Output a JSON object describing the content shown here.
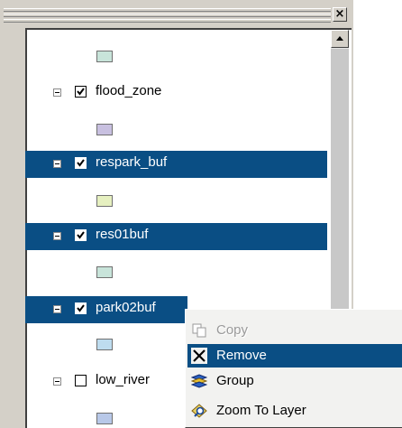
{
  "window": {
    "close_glyph": "×"
  },
  "toc": {
    "layers": [
      {
        "name": "flood_zone",
        "checked": true,
        "selected": false,
        "swatch_color": "#c8c0e0"
      },
      {
        "name": "respark_buf",
        "checked": true,
        "selected": true,
        "swatch_color": "#e6f0c0"
      },
      {
        "name": "res01buf",
        "checked": true,
        "selected": true,
        "swatch_color": "#c8e4da"
      },
      {
        "name": "park02buf",
        "checked": true,
        "selected": true,
        "swatch_color": "#bedcef"
      },
      {
        "name": "low_river",
        "checked": false,
        "selected": false,
        "swatch_color": "#b8c8e8"
      }
    ],
    "top_swatch_color": "#c8e4da"
  },
  "context_menu": {
    "items": [
      {
        "label": "Copy",
        "icon": "copy-icon",
        "disabled": true,
        "highlighted": false
      },
      {
        "label": "Remove",
        "icon": "remove-x-icon",
        "disabled": false,
        "highlighted": true
      },
      {
        "label": "Group",
        "icon": "group-layers-icon",
        "disabled": false,
        "highlighted": false
      },
      {
        "label": "Zoom To Layer",
        "icon": "zoom-to-layer-icon",
        "disabled": false,
        "highlighted": false
      }
    ]
  },
  "colors": {
    "selection": "#0a4e84",
    "panel": "#d4d0c8"
  }
}
